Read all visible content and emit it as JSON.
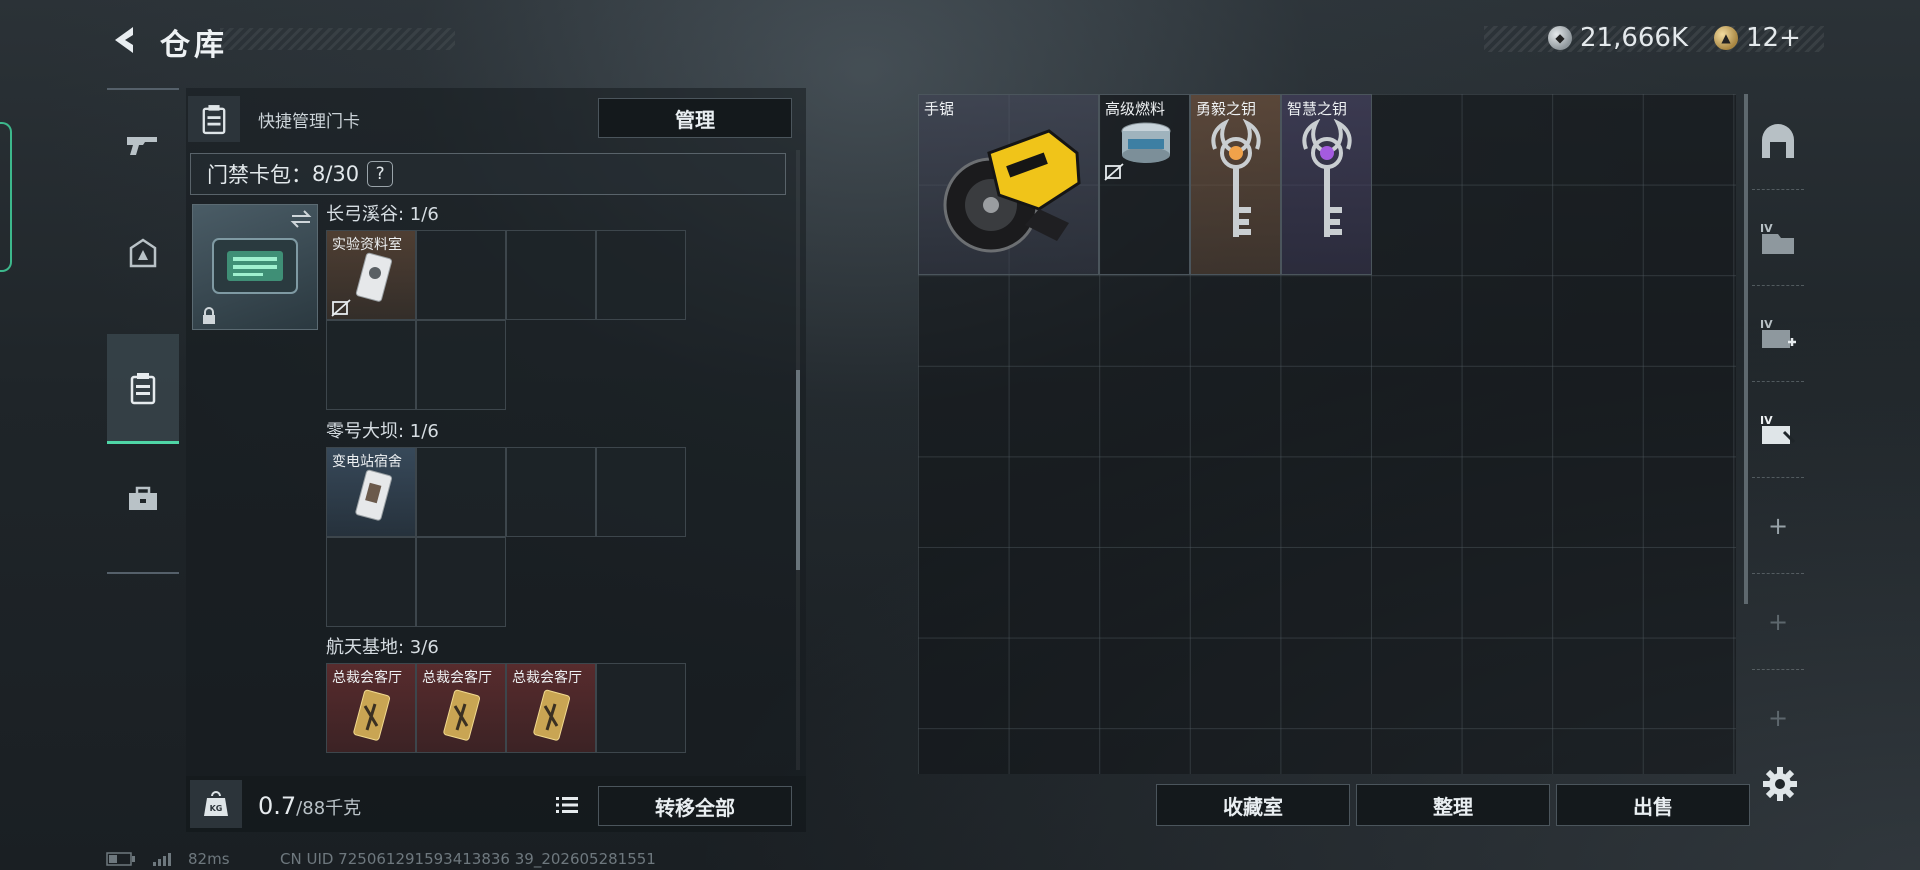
{
  "header": {
    "title": "仓库",
    "currencies": [
      {
        "icon": "silver-coin-icon",
        "value": "21,666K"
      },
      {
        "icon": "gold-coin-icon",
        "value": "12+"
      }
    ]
  },
  "left_nav": {
    "items": [
      {
        "name": "weapon-tab",
        "icon": "gun-icon"
      },
      {
        "name": "gear-tab",
        "icon": "armor-icon"
      },
      {
        "name": "keycard-tab",
        "icon": "keycard-case-icon",
        "active": true
      },
      {
        "name": "toolbox-tab",
        "icon": "toolbox-icon"
      }
    ]
  },
  "keycard_panel": {
    "header_label": "快捷管理门卡",
    "manage_label": "管理",
    "card_bag_label": "门禁卡包：",
    "card_bag_count": "8/30",
    "help_label": "?",
    "regions": [
      {
        "name": "长弓溪谷",
        "count": "1/6",
        "items": [
          {
            "label": "实验资料室",
            "rarity": "brown"
          }
        ]
      },
      {
        "name": "零号大坝",
        "count": "1/6",
        "items": [
          {
            "label": "变电站宿舍",
            "rarity": "blue"
          }
        ]
      },
      {
        "name": "航天基地",
        "count": "3/6",
        "items": [
          {
            "label": "总裁会客厅",
            "rarity": "red"
          },
          {
            "label": "总裁会客厅",
            "rarity": "red"
          },
          {
            "label": "总裁会客厅",
            "rarity": "red"
          }
        ]
      }
    ],
    "weight_value": "0.7",
    "weight_capacity": "/88千克",
    "transfer_all_label": "转移全部"
  },
  "storage": {
    "items": [
      {
        "label": "手锯",
        "icon": "circular-saw-icon"
      },
      {
        "label": "高级燃料",
        "icon": "fuel-can-icon"
      },
      {
        "label": "勇毅之钥",
        "icon": "orange-gem-key-icon"
      },
      {
        "label": "智慧之钥",
        "icon": "purple-gem-key-icon"
      }
    ],
    "buttons": [
      "收藏室",
      "整理",
      "出售"
    ]
  },
  "status": {
    "ping": "82ms",
    "uid": "CN UID 725061291593413836 39_202605281551"
  }
}
